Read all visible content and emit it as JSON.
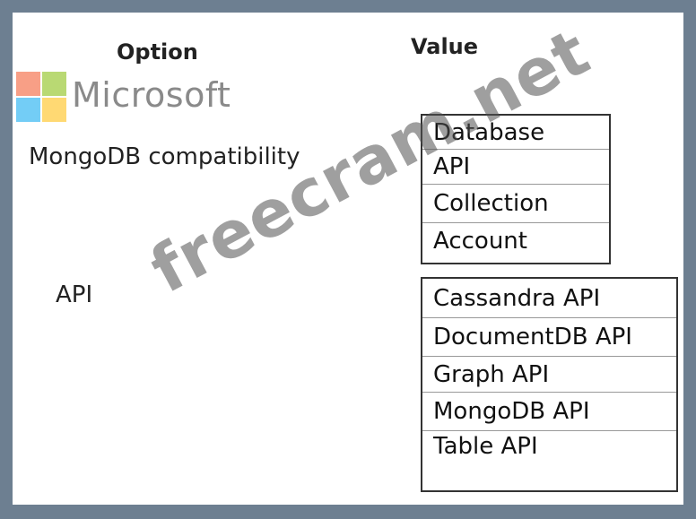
{
  "headers": {
    "option": "Option",
    "value": "Value"
  },
  "logo": {
    "text": "Microsoft",
    "colors": [
      "#f25022",
      "#7fba00",
      "#00a4ef",
      "#ffb900"
    ]
  },
  "rows": [
    {
      "option": "MongoDB compatibility",
      "values": [
        "Database",
        "API",
        "Collection",
        "Account"
      ]
    },
    {
      "option": "API",
      "values": [
        "Cassandra API",
        "DocumentDB API",
        "Graph API",
        "MongoDB API",
        "Table API"
      ]
    }
  ],
  "watermark": "freecram.net"
}
